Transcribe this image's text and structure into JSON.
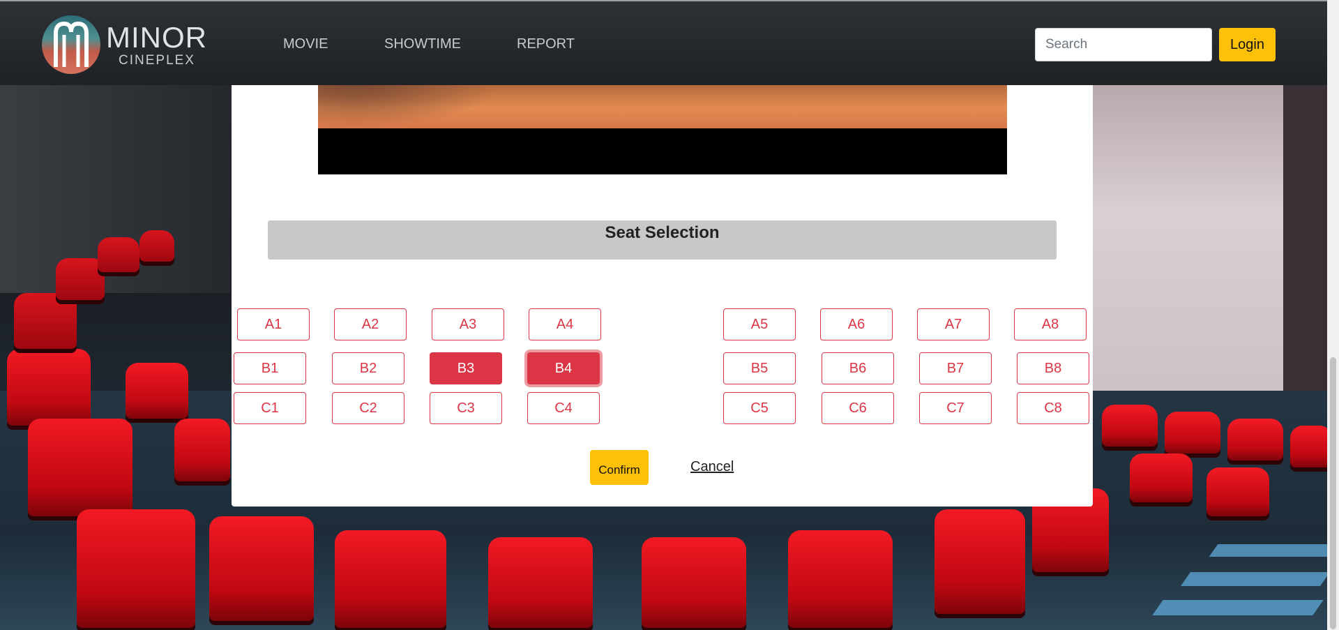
{
  "brand": {
    "word1": "MINOR",
    "word2": "CINEPLEX"
  },
  "nav": {
    "links": [
      {
        "label": "MOVIE"
      },
      {
        "label": "SHOWTIME"
      },
      {
        "label": "REPORT"
      }
    ],
    "search_placeholder": "Search",
    "login_label": "Login"
  },
  "seat_section": {
    "title": "Seat Selection",
    "rows": [
      {
        "row": "A",
        "seats": [
          "A1",
          "A2",
          "A3",
          "A4",
          "A5",
          "A6",
          "A7",
          "A8"
        ]
      },
      {
        "row": "B",
        "seats": [
          "B1",
          "B2",
          "B3",
          "B4",
          "B5",
          "B6",
          "B7",
          "B8"
        ]
      },
      {
        "row": "C",
        "seats": [
          "C1",
          "C2",
          "C3",
          "C4",
          "C5",
          "C6",
          "C7",
          "C8"
        ]
      }
    ],
    "selected": [
      "B3",
      "B4"
    ],
    "confirm_label": "Confirm",
    "cancel_label": "Cancel"
  },
  "colors": {
    "accent_yellow": "#ffc107",
    "seat_red": "#dc3545",
    "nav_bg": "#2e3136"
  },
  "icons": [
    "minor-cineplex-logo"
  ]
}
